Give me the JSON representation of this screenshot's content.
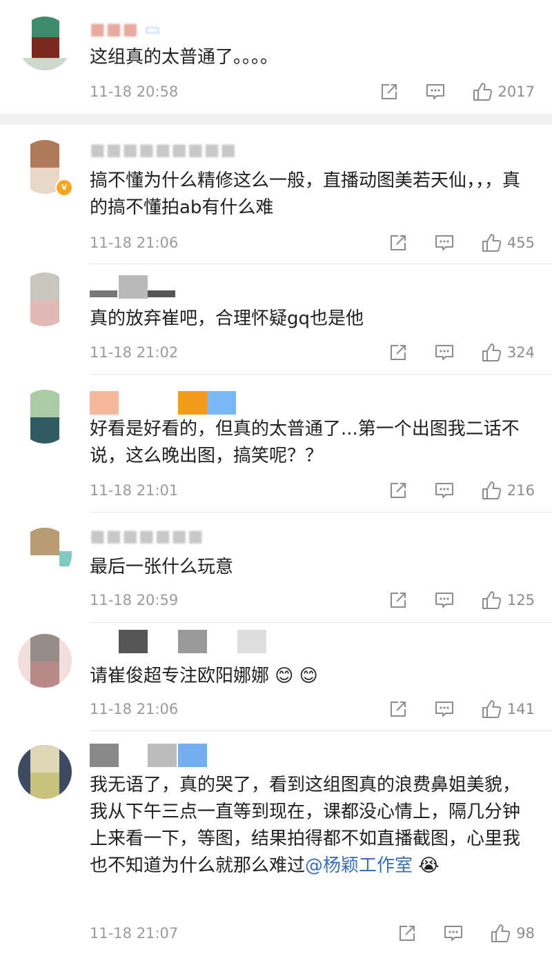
{
  "comments": [
    {
      "text_parts": [
        {
          "t": "这组真的太普通了。。。。"
        }
      ],
      "time": "11-18 20:58",
      "likes": "2017"
    },
    {
      "text_parts": [
        {
          "t": "搞不懂为什么精修这么一般，直播动图美若天仙，，，真的搞不懂拍ab有什么难"
        }
      ],
      "time": "11-18 21:06",
      "likes": "455"
    },
    {
      "text_parts": [
        {
          "t": "真的放弃崔吧，合理怀疑gq也是他"
        }
      ],
      "time": "11-18 21:02",
      "likes": "324"
    },
    {
      "text_parts": [
        {
          "t": "好看是好看的，但真的太普通了...第一个出图我二话不说，这么晚出图，搞笑呢？？"
        }
      ],
      "time": "11-18 21:01",
      "likes": "216"
    },
    {
      "text_parts": [
        {
          "t": "最后一张什么玩意"
        }
      ],
      "time": "11-18 20:59",
      "likes": "125"
    },
    {
      "text_parts": [
        {
          "t": "请崔俊超专注欧阳娜娜"
        }
      ],
      "time": "11-18 21:06",
      "likes": "141"
    },
    {
      "text_parts": [
        {
          "t": "我无语了，真的哭了，看到这组图真的浪费鼻姐美貌，我从下午三点一直等到现在，课都没心情上，隔几分钟上来看一下，等图，结果拍得都不如直播截图，心里我也不知道为什么就那么难过"
        },
        {
          "t": "@杨颖工作室"
        }
      ],
      "time": "11-18 21:07",
      "likes": "98"
    }
  ],
  "emoji": {
    "blush": "😊",
    "cry": "😭"
  },
  "colors": {
    "mention": "#3a6fb4",
    "meta": "#9a9a9a",
    "divider": "#e6e6e6",
    "section_gap": "#f1f1f1"
  },
  "icons": {
    "share": "share-icon",
    "reply": "comment-icon",
    "like": "thumbs-up-icon"
  }
}
